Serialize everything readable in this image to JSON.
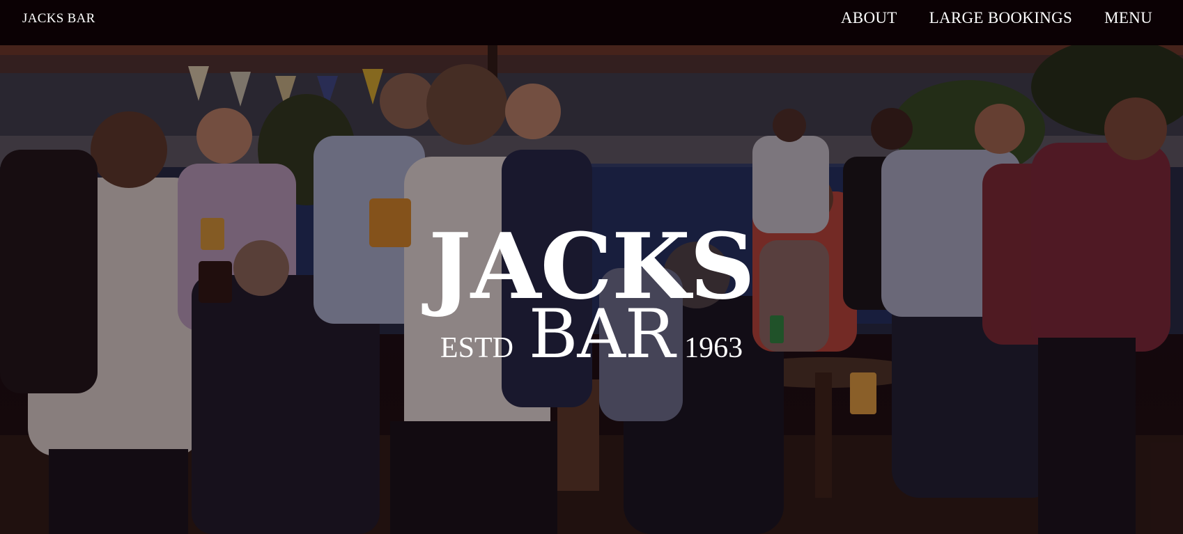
{
  "nav": {
    "brand": "JACKS BAR",
    "links": [
      {
        "label": "ABOUT"
      },
      {
        "label": "LARGE BOOKINGS"
      },
      {
        "label": "MENU"
      }
    ]
  },
  "hero": {
    "title_top": "JACKS",
    "established_label": "ESTD",
    "title_bottom": "BAR",
    "established_year": "1963",
    "background_image": "beer-garden-crowd-photo"
  },
  "colors": {
    "navbar_bg": "#0b0104",
    "text": "#ffffff",
    "overlay": "#14040a"
  }
}
